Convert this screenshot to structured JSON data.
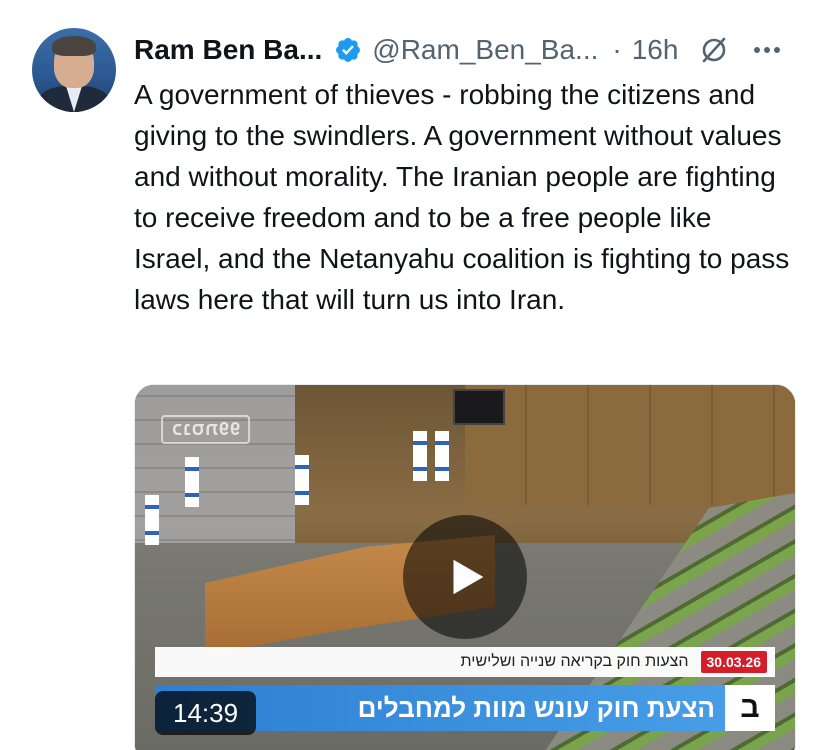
{
  "author": {
    "name": "Ram Ben Ba...",
    "handle": "@Ram_Ben_Ba...",
    "separator": "·",
    "time": "16h",
    "verified": true
  },
  "icons": {
    "verified": "verified-badge-icon",
    "grok": "grok-slash-icon",
    "more": "more-dots-icon",
    "play": "play-icon"
  },
  "tweet": {
    "text": "A government of thieves - robbing the citizens and giving to the swindlers. A government without values and without morality. The Iranian people are fighting to receive freedom and to be a free people like Israel, and the Netanyahu coalition is fighting to pass laws here that will turn us into Iran."
  },
  "video": {
    "duration": "14:39",
    "watermark": "99כנסת",
    "ticker_top": "הצעות חוק בקריאה שנייה ושלישית",
    "date": "30.03.26",
    "ticker_main": "הצעת חוק עונש מוות למחבלים",
    "channel_logo": "ב"
  },
  "colors": {
    "text": "#0f1419",
    "secondary": "#536471",
    "verified": "#1d9bf0",
    "ticker_blue": "#2d7fd2",
    "ticker_red": "#d41f2a"
  }
}
